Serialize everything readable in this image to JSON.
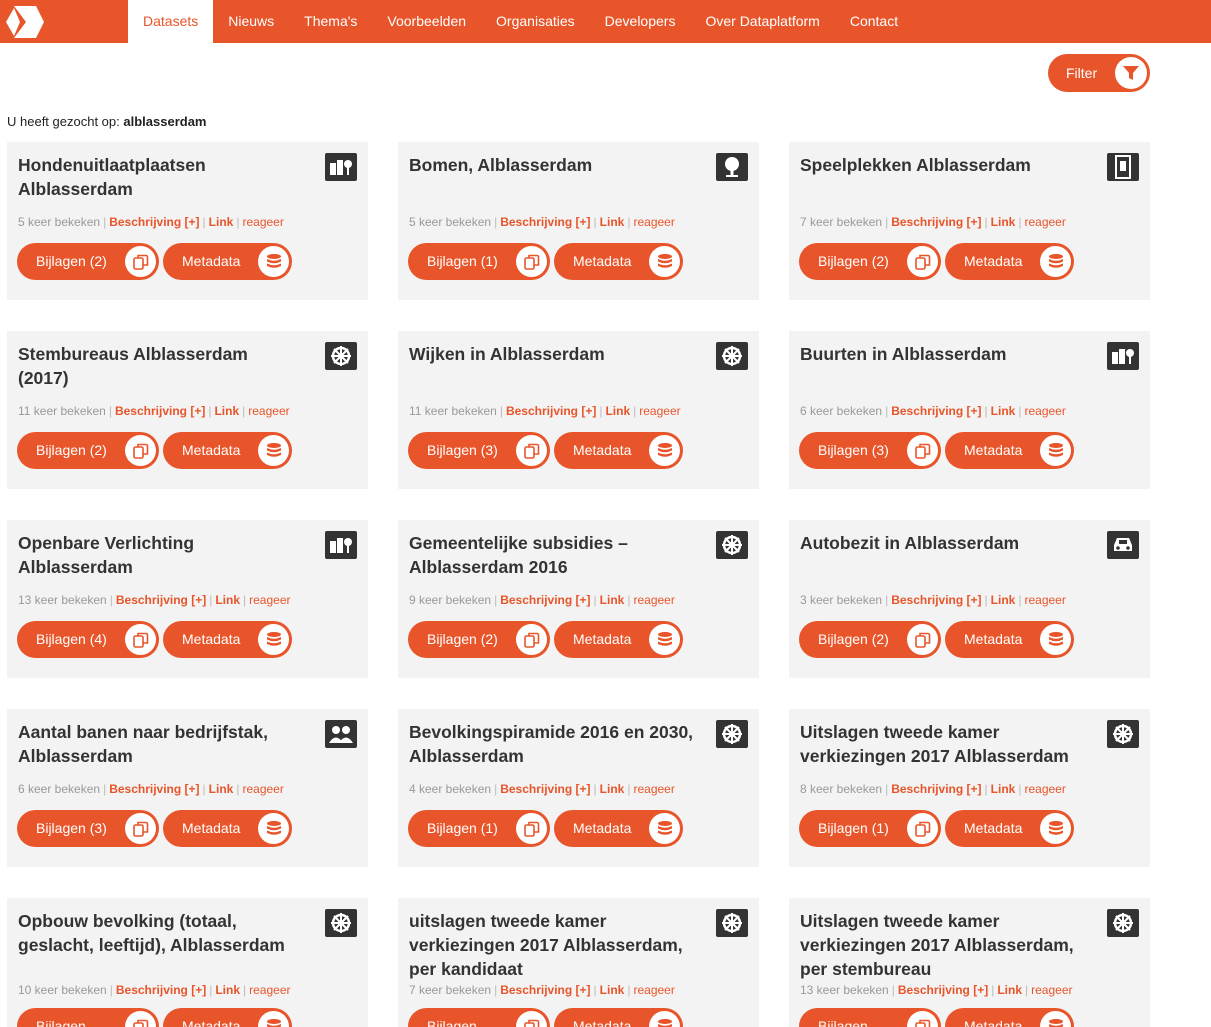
{
  "nav": {
    "items": [
      "Datasets",
      "Nieuws",
      "Thema's",
      "Voorbeelden",
      "Organisaties",
      "Developers",
      "Over Dataplatform",
      "Contact"
    ],
    "active_index": 0
  },
  "filter": {
    "label": "Filter"
  },
  "search": {
    "prefix": "U heeft gezocht op:",
    "term": "alblasserdam"
  },
  "labels": {
    "views_suffix": "keer bekeken",
    "beschrijving": "Beschrijving [+]",
    "link": "Link",
    "reageer": "reageer",
    "bijlagen": "Bijlagen",
    "metadata": "Metadata"
  },
  "colors": {
    "accent": "#e8552a",
    "card_bg": "#f3f3f3",
    "icon_bg": "#333333"
  },
  "cards": [
    {
      "title": "Hondenuitlaatplaatsen Alblasserdam",
      "views": "5",
      "bijlagen_count": "(2)",
      "icon": "city-icon"
    },
    {
      "title": "Bomen, Alblasserdam",
      "views": "5",
      "bijlagen_count": "(1)",
      "icon": "tree-icon"
    },
    {
      "title": "Speelplekken Alblasserdam",
      "views": "7",
      "bijlagen_count": "(2)",
      "icon": "playground-icon"
    },
    {
      "title": "Stembureaus Alblasserdam (2017)",
      "views": "11",
      "bijlagen_count": "(2)",
      "icon": "wheel-icon"
    },
    {
      "title": "Wijken in Alblasserdam",
      "views": "11",
      "bijlagen_count": "(3)",
      "icon": "wheel-icon"
    },
    {
      "title": "Buurten in Alblasserdam",
      "views": "6",
      "bijlagen_count": "(3)",
      "icon": "city-icon"
    },
    {
      "title": "Openbare Verlichting Alblasserdam",
      "views": "13",
      "bijlagen_count": "(4)",
      "icon": "city-icon"
    },
    {
      "title": "Gemeentelijke subsidies – Alblasserdam 2016",
      "views": "9",
      "bijlagen_count": "(2)",
      "icon": "wheel-icon"
    },
    {
      "title": "Autobezit in Alblasserdam",
      "views": "3",
      "bijlagen_count": "(2)",
      "icon": "car-icon"
    },
    {
      "title": "Aantal banen naar bedrijfstak, Alblasserdam",
      "views": "6",
      "bijlagen_count": "(3)",
      "icon": "people-icon"
    },
    {
      "title": "Bevolkingspiramide 2016 en 2030, Alblasserdam",
      "views": "4",
      "bijlagen_count": "(1)",
      "icon": "wheel-icon"
    },
    {
      "title": "Uitslagen tweede kamer verkiezingen 2017 Alblasserdam",
      "views": "8",
      "bijlagen_count": "(1)",
      "icon": "wheel-icon"
    },
    {
      "title": "Opbouw bevolking (totaal, geslacht, leeftijd), Alblasserdam",
      "views": "10",
      "bijlagen_count": "",
      "icon": "wheel-icon"
    },
    {
      "title": "uitslagen tweede kamer verkiezingen 2017 Alblasserdam, per kandidaat",
      "views": "7",
      "bijlagen_count": "",
      "icon": "wheel-icon"
    },
    {
      "title": "Uitslagen tweede kamer verkiezingen 2017 Alblasserdam, per stembureau",
      "views": "13",
      "bijlagen_count": "",
      "icon": "wheel-icon"
    }
  ]
}
